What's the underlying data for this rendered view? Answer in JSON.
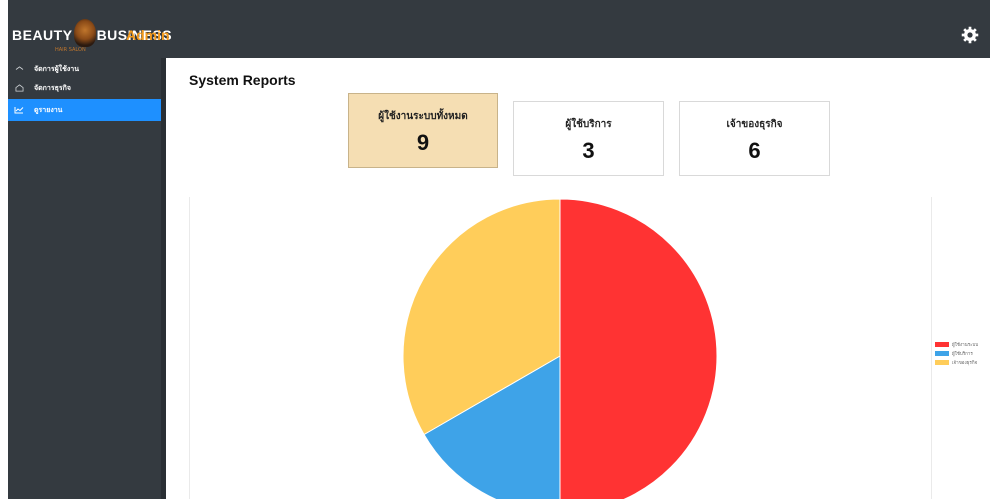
{
  "header": {
    "logo_left": "BEAUTY",
    "logo_right": "BUSINESS",
    "logo_tagline": "HAIR SALON",
    "admin_label": "Admin"
  },
  "sidebar": {
    "items": [
      {
        "label": "จัดการผู้ใช้งาน",
        "icon": "home-icon"
      },
      {
        "label": "จัดการธุรกิจ",
        "icon": "house-icon"
      },
      {
        "label": "ดูรายงาน",
        "icon": "chart-icon",
        "active": true
      }
    ]
  },
  "main": {
    "title": "System Reports",
    "cards": [
      {
        "label": "ผู้ใช้งานระบบทั้งหมด",
        "value": "9"
      },
      {
        "label": "ผู้ใช้บริการ",
        "value": "3"
      },
      {
        "label": "เจ้าของธุรกิจ",
        "value": "6"
      }
    ]
  },
  "chart_data": {
    "type": "pie",
    "labels": [
      "ผู้ใช้งานระบบ",
      "ผู้ใช้บริการ",
      "เจ้าของธุรกิจ"
    ],
    "values": [
      9,
      3,
      6
    ],
    "colors": [
      "#ff3333",
      "#3ea3e8",
      "#ffcd5a"
    ],
    "legend_position": "right"
  }
}
